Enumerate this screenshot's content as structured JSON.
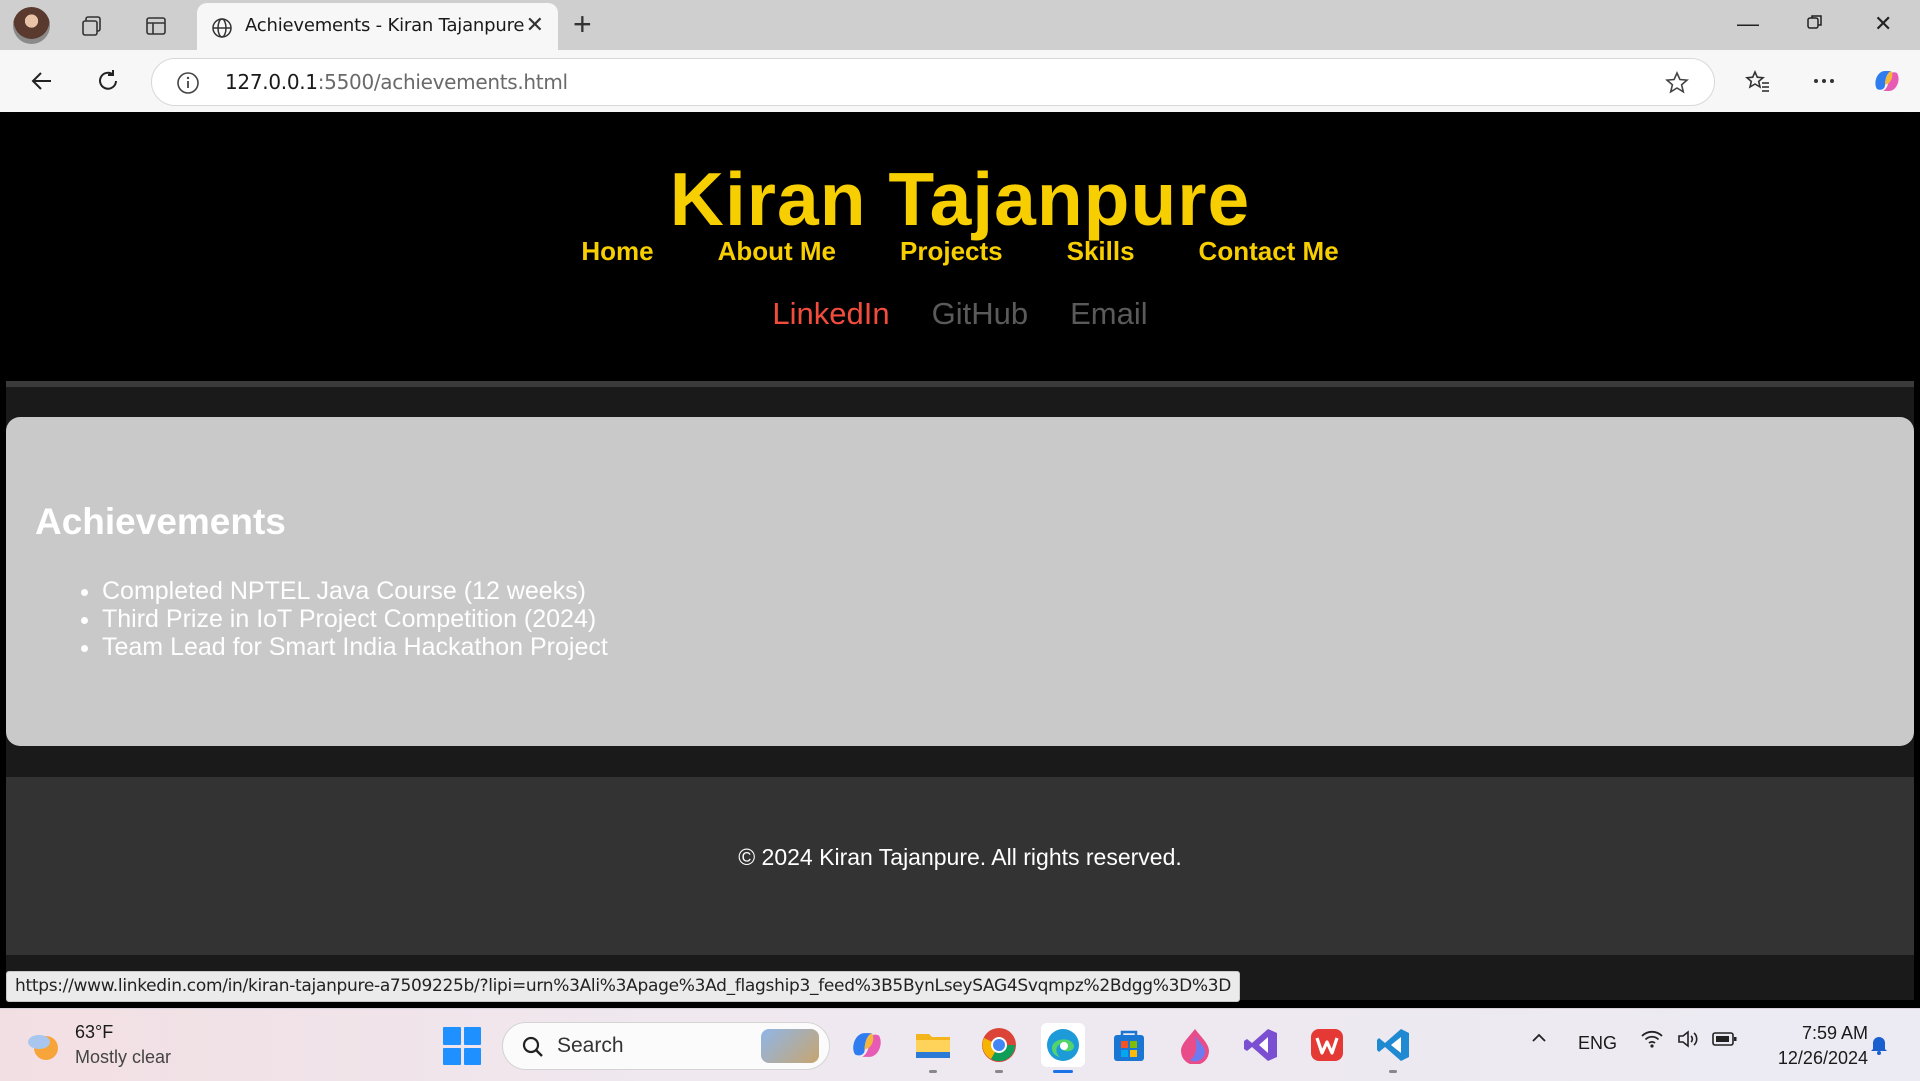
{
  "browser": {
    "tab_title": "Achievements - Kiran Tajanpure",
    "url_host": "127.0.0.1",
    "url_rest": ":5500/achievements.html",
    "status_url": "https://www.linkedin.com/in/kiran-tajanpure-a7509225b/?lipi=urn%3Ali%3Apage%3Ad_flagship3_feed%3B5BynLseySAG4Svqmpz%2Bdgg%3D%3D"
  },
  "site": {
    "title": "Kiran Tajanpure",
    "nav": [
      "Home",
      "About Me",
      "Projects",
      "Skills",
      "Contact Me"
    ],
    "social": [
      "LinkedIn",
      "GitHub",
      "Email"
    ],
    "section_heading": "Achievements",
    "achievements": [
      "Completed NPTEL Java Course (12 weeks)",
      "Third Prize in IoT Project Competition (2024)",
      "Team Lead for Smart India Hackathon Project"
    ],
    "footer": "© 2024 Kiran Tajanpure. All rights reserved.",
    "colors": {
      "accent": "#f7ce00",
      "linkedin": "#f24c3d",
      "muted_link": "#5a5a5a",
      "section_bg": "#c9c9c9",
      "footer_bg": "#333333"
    }
  },
  "taskbar": {
    "weather_temp": "63°F",
    "weather_desc": "Mostly clear",
    "search_placeholder": "Search",
    "language": "ENG",
    "time": "7:59 AM",
    "date": "12/26/2024",
    "apps": [
      "copilot-icon",
      "file-explorer-icon",
      "chrome-icon",
      "edge-icon",
      "microsoft-store-icon",
      "paint-icon",
      "visual-studio-icon",
      "wps-office-icon",
      "vscode-icon"
    ]
  }
}
